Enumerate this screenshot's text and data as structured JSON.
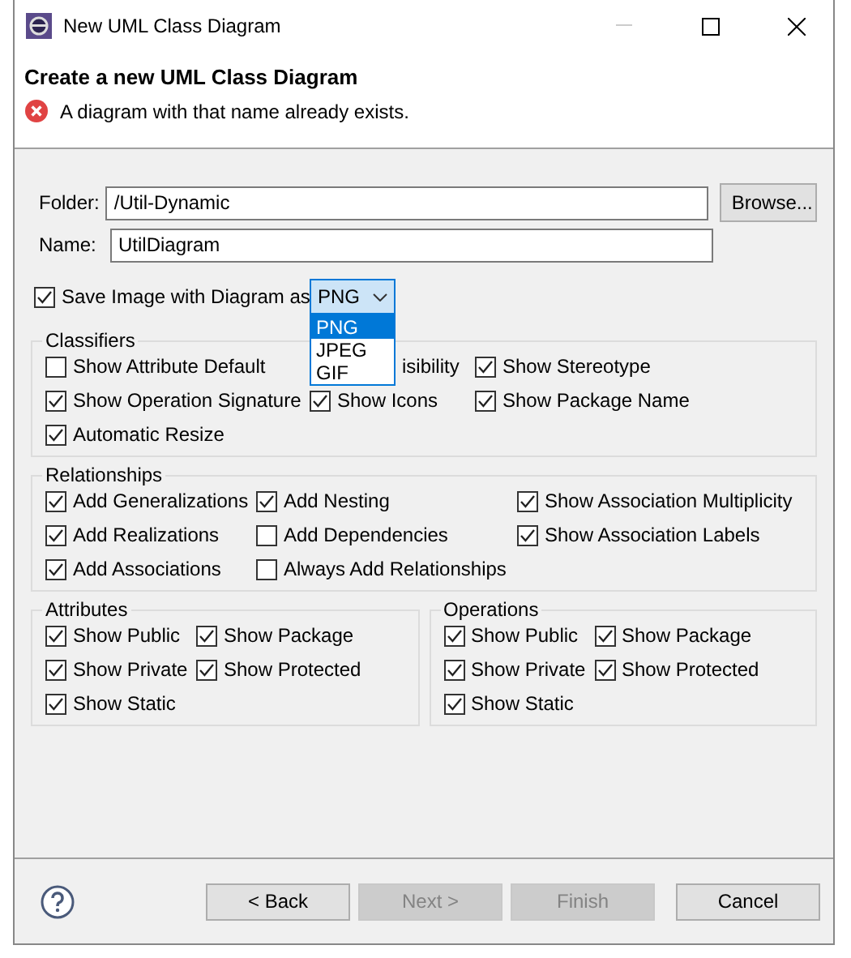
{
  "window": {
    "title": "New UML Class Diagram"
  },
  "header": {
    "title": "Create a new UML Class Diagram",
    "error": "A diagram with that name already exists."
  },
  "fields": [
    {
      "label": "Folder:",
      "value": "/Util-Dynamic",
      "button": "Browse..."
    },
    {
      "label": "Name:",
      "value": "UtilDiagram"
    }
  ],
  "save_image": {
    "label": "Save Image with Diagram as",
    "checked": true,
    "format": "PNG",
    "options": [
      {
        "label": "PNG",
        "selected": true
      },
      {
        "label": "JPEG",
        "selected": false
      },
      {
        "label": "GIF",
        "selected": false
      }
    ]
  },
  "groups": [
    {
      "title": "Classifiers",
      "items": [
        {
          "kind": "checkbox",
          "label": "Show Attribute Default",
          "checked": false
        },
        {
          "kind": "covered",
          "label": "isibility"
        },
        {
          "kind": "checkbox",
          "label": "Show Stereotype",
          "checked": true
        },
        {
          "kind": "checkbox",
          "label": "Show Operation Signature",
          "checked": true
        },
        {
          "kind": "checkbox",
          "label": "Show Icons",
          "checked": true
        },
        {
          "kind": "checkbox",
          "label": "Show Package Name",
          "checked": true
        },
        {
          "kind": "checkbox",
          "label": "Automatic Resize",
          "checked": true
        }
      ]
    },
    {
      "title": "Relationships",
      "items": [
        {
          "kind": "checkbox",
          "label": "Add Generalizations",
          "checked": true
        },
        {
          "kind": "checkbox",
          "label": "Add Nesting",
          "checked": true
        },
        {
          "kind": "checkbox",
          "label": "Show Association Multiplicity",
          "checked": true
        },
        {
          "kind": "checkbox",
          "label": "Add Realizations",
          "checked": true
        },
        {
          "kind": "checkbox",
          "label": "Add Dependencies",
          "checked": false
        },
        {
          "kind": "checkbox",
          "label": "Show Association Labels",
          "checked": true
        },
        {
          "kind": "checkbox",
          "label": "Add Associations",
          "checked": true
        },
        {
          "kind": "checkbox",
          "label": "Always Add Relationships",
          "checked": false
        }
      ]
    }
  ],
  "side_groups": [
    {
      "title": "Attributes",
      "items": [
        {
          "kind": "checkbox",
          "label": "Show Public",
          "checked": true
        },
        {
          "kind": "checkbox",
          "label": "Show Package",
          "checked": true
        },
        {
          "kind": "checkbox",
          "label": "Show Private",
          "checked": true
        },
        {
          "kind": "checkbox",
          "label": "Show Protected",
          "checked": true
        },
        {
          "kind": "checkbox",
          "label": "Show Static",
          "checked": true
        }
      ]
    },
    {
      "title": "Operations",
      "items": [
        {
          "kind": "checkbox",
          "label": "Show Public",
          "checked": true
        },
        {
          "kind": "checkbox",
          "label": "Show Package",
          "checked": true
        },
        {
          "kind": "checkbox",
          "label": "Show Private",
          "checked": true
        },
        {
          "kind": "checkbox",
          "label": "Show Protected",
          "checked": true
        },
        {
          "kind": "checkbox",
          "label": "Show Static",
          "checked": true
        }
      ]
    }
  ],
  "buttons": [
    {
      "label": "< Back",
      "disabled": false
    },
    {
      "label": "Next >",
      "disabled": true
    },
    {
      "label": "Finish",
      "disabled": true
    },
    {
      "label": "Cancel",
      "disabled": false
    }
  ]
}
